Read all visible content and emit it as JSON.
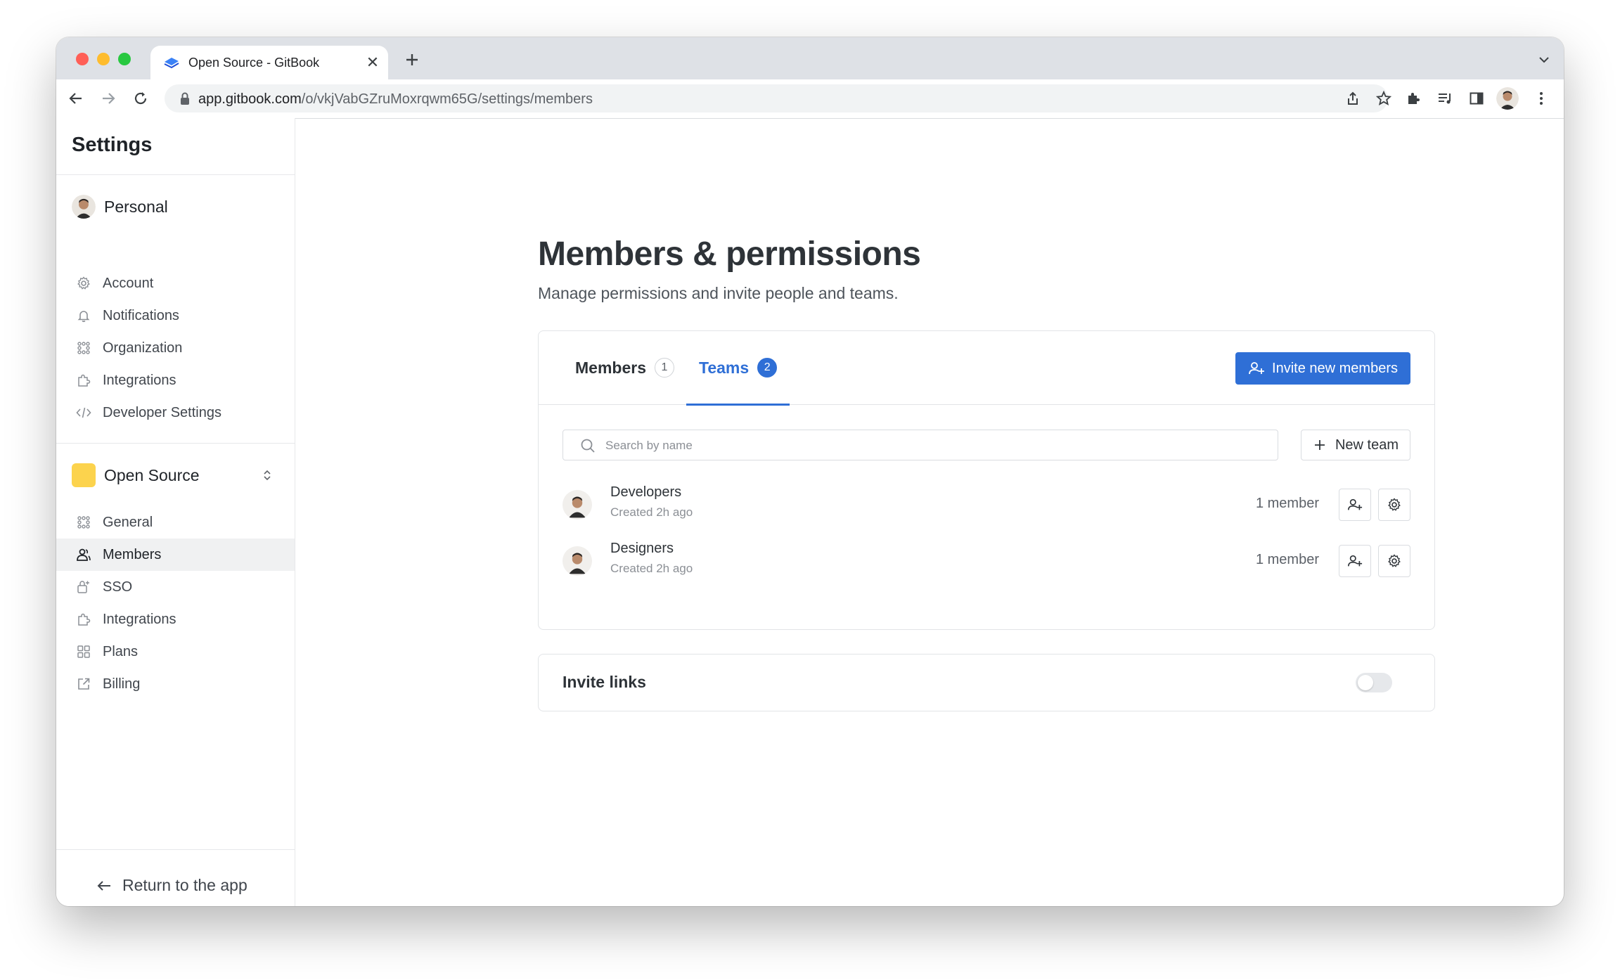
{
  "browser": {
    "tab_title": "Open Source - GitBook",
    "url_host": "app.gitbook.com",
    "url_path": "/o/vkjVabGZruMoxrqwm65G/settings/members"
  },
  "sidebar": {
    "title": "Settings",
    "personal": {
      "label": "Personal",
      "items": [
        {
          "label": "Account",
          "icon": "gear-icon"
        },
        {
          "label": "Notifications",
          "icon": "bell-icon"
        },
        {
          "label": "Organization",
          "icon": "organization-icon"
        },
        {
          "label": "Integrations",
          "icon": "puzzle-icon"
        },
        {
          "label": "Developer Settings",
          "icon": "code-icon"
        }
      ]
    },
    "organization": {
      "label": "Open Source",
      "color": "#fcd34d",
      "items": [
        {
          "label": "General",
          "icon": "organization-icon"
        },
        {
          "label": "Members",
          "icon": "members-icon",
          "active": true
        },
        {
          "label": "SSO",
          "icon": "sso-icon"
        },
        {
          "label": "Integrations",
          "icon": "puzzle-icon"
        },
        {
          "label": "Plans",
          "icon": "grid-icon"
        },
        {
          "label": "Billing",
          "icon": "external-link-icon"
        }
      ]
    },
    "return_label": "Return to the app"
  },
  "main": {
    "title": "Members & permissions",
    "subtitle": "Manage permissions and invite people and teams.",
    "tabs": [
      {
        "label": "Members",
        "count": "1"
      },
      {
        "label": "Teams",
        "count": "2",
        "active": true
      }
    ],
    "invite_button": "Invite new members",
    "search_placeholder": "Search by name",
    "new_team_button": "New team",
    "teams": [
      {
        "name": "Developers",
        "created": "Created 2h ago",
        "members": "1 member"
      },
      {
        "name": "Designers",
        "created": "Created 2h ago",
        "members": "1 member"
      }
    ],
    "invite_links": {
      "label": "Invite links",
      "enabled": false
    }
  },
  "colors": {
    "accent": "#2f6fd6",
    "org_badge": "#fcd34d"
  }
}
